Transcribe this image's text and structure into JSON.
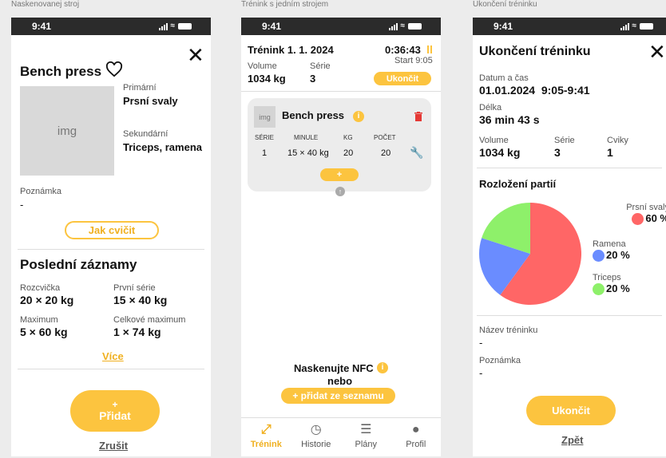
{
  "frames": {
    "left": "Naskenovanej stroj",
    "middle": "Trénink s jedním strojem",
    "right": "Ukončení tréninku"
  },
  "status": {
    "time": "9:41"
  },
  "exercise": {
    "name": "Bench press",
    "image_placeholder": "img",
    "primary_label": "Primární",
    "primary_value": "Prsní svaly",
    "secondary_label": "Sekundární",
    "secondary_value": "Triceps, ramena",
    "note_label": "Poznámka",
    "note_value": "-",
    "how_button": "Jak cvičit",
    "records_title": "Poslední záznamy",
    "warmup_label": "Rozcvička",
    "warmup_value": "20 × 20 kg",
    "first_set_label": "První série",
    "first_set_value": "15 × 40 kg",
    "max_label": "Maximum",
    "max_value": "5 × 60 kg",
    "total_max_label": "Celkové maximum",
    "total_max_value": "1 × 74 kg",
    "more_link": "Více",
    "add_plus": "+",
    "add_label": "Přidat",
    "cancel_link": "Zrušit"
  },
  "workout": {
    "title": "Trénink 1. 1. 2024",
    "timer": "0:36:43",
    "start": "Start 9:05",
    "volume_label": "Volume",
    "volume_value": "1034 kg",
    "sets_label": "Série",
    "sets_value": "3",
    "finish_button": "Ukončit",
    "card": {
      "img": "img",
      "name": "Bench press",
      "headers": [
        "SÉRIE",
        "MINULE",
        "KG",
        "POČET"
      ],
      "row": [
        "1",
        "15 × 40 kg",
        "20",
        "20"
      ],
      "add": "+"
    },
    "nfc_text": "Naskenujte NFC",
    "or_text": "nebo",
    "add_from_list": "+ přidat ze seznamu",
    "tabs": [
      {
        "label": "Trénink",
        "icon": "dumbbell-icon",
        "active": true
      },
      {
        "label": "Historie",
        "icon": "clock-icon",
        "active": false
      },
      {
        "label": "Plány",
        "icon": "list-icon",
        "active": false
      },
      {
        "label": "Profil",
        "icon": "user-icon",
        "active": false
      }
    ]
  },
  "summary": {
    "title": "Ukončení tréninku",
    "datetime_label": "Datum a čas",
    "datetime_value": "01.01.2024  9:05-9:41",
    "length_label": "Délka",
    "length_value": "36 min 43 s",
    "volume_label": "Volume",
    "volume_value": "1034 kg",
    "sets_label": "Série",
    "sets_value": "3",
    "exercises_label": "Cviky",
    "exercises_value": "1",
    "distribution_title": "Rozložení partií",
    "name_label": "Název tréninku",
    "name_value": "-",
    "note_label": "Poznámka",
    "note_value": "-",
    "finish_button": "Ukončit",
    "back_link": "Zpět"
  },
  "chart_data": {
    "type": "pie",
    "series": [
      {
        "name": "Prsní svaly",
        "value": 60,
        "label": "60 %",
        "color": "#ff6666"
      },
      {
        "name": "Ramena",
        "value": 20,
        "label": "20 %",
        "color": "#6a8cff"
      },
      {
        "name": "Triceps",
        "value": 20,
        "label": "20 %",
        "color": "#8ef06a"
      }
    ]
  },
  "colors": {
    "accent": "#fcc43f",
    "delete": "#e53935"
  }
}
